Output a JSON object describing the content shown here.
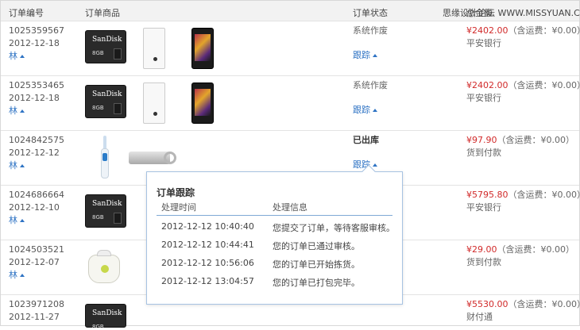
{
  "header": {
    "col_id": "订单编号",
    "col_goods": "订单商品",
    "col_status": "订单状态",
    "col_price": "总金额",
    "watermark": "思缘设计论坛 WWW.MISSYUAN.COM"
  },
  "rows": [
    {
      "id": "1025359567",
      "date": "2012-12-18",
      "user": "林",
      "status": "系统作废",
      "status_bold": false,
      "track": "跟踪",
      "amount": "¥2402.00",
      "shipping": "（含运费：¥0.00）",
      "payment": "平安银行"
    },
    {
      "id": "1025353465",
      "date": "2012-12-18",
      "user": "林",
      "status": "系统作废",
      "status_bold": false,
      "track": "跟踪",
      "amount": "¥2402.00",
      "shipping": "（含运费：¥0.00）",
      "payment": "平安银行"
    },
    {
      "id": "1024842575",
      "date": "2012-12-12",
      "user": "林",
      "status": "已出库",
      "status_bold": true,
      "track": "跟踪",
      "amount": "¥97.90",
      "shipping": "（含运费：¥0.00）",
      "payment": "货到付款"
    },
    {
      "id": "1024686664",
      "date": "2012-12-10",
      "user": "林",
      "status": "",
      "status_bold": false,
      "track": "",
      "amount": "¥5795.80",
      "shipping": "（含运费：¥0.00）",
      "payment": "平安银行"
    },
    {
      "id": "1024503521",
      "date": "2012-12-07",
      "user": "林",
      "status": "",
      "status_bold": false,
      "track": "",
      "amount": "¥29.00",
      "shipping": "（含运费：¥0.00）",
      "payment": "货到付款"
    },
    {
      "id": "1023971208",
      "date": "2012-11-27",
      "user": "",
      "status": "",
      "status_bold": false,
      "track": "",
      "amount": "¥5530.00",
      "shipping": "（含运费：¥0.00）",
      "payment": "财付通"
    }
  ],
  "products": {
    "sandisk_brand": "SanDisk",
    "sandisk_size": "8GB"
  },
  "popup": {
    "title": "订单跟踪",
    "col_time": "处理时间",
    "col_info": "处理信息",
    "entries": [
      {
        "time": "2012-12-12 10:40:40",
        "info": "您提交了订单，等待客服审核。"
      },
      {
        "time": "2012-12-12 10:44:41",
        "info": "您的订单已通过审核。"
      },
      {
        "time": "2012-12-12 10:56:06",
        "info": "您的订单已开始拣货。"
      },
      {
        "time": "2012-12-12 13:04:57",
        "info": "您的订单已打包完毕。"
      }
    ]
  },
  "colors": {
    "price_red": "#d12a2a",
    "link_blue": "#2e73c4",
    "popup_border": "#a7c3e2"
  }
}
